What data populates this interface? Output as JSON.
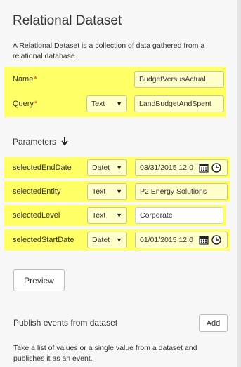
{
  "title": "Relational Dataset",
  "description": "A Relational Dataset is a collection of data gathered from a relational database.",
  "name_field": {
    "label": "Name",
    "required_mark": "*",
    "value": "BudgetVersusActual"
  },
  "query_field": {
    "label": "Query",
    "required_mark": "*",
    "type": "Text",
    "value": "LandBudgetAndSpent"
  },
  "parameters": {
    "heading": "Parameters",
    "items": [
      {
        "name": "selectedEndDate",
        "type": "Datet",
        "value": "03/31/2015 12:0",
        "kind": "datetime"
      },
      {
        "name": "selectedEntity",
        "type": "Text",
        "value": "P2 Energy Solutions",
        "kind": "text"
      },
      {
        "name": "selectedLevel",
        "type": "Text",
        "value": "Corporate",
        "kind": "text"
      },
      {
        "name": "selectedStartDate",
        "type": "Datet",
        "value": "01/01/2015 12:0",
        "kind": "datetime"
      }
    ]
  },
  "preview_button": "Preview",
  "publish": {
    "heading": "Publish events from dataset",
    "add_button": "Add",
    "description": "Take a list of values or a single value from a dataset and publishes it as an event."
  },
  "colors": {
    "highlight": "#ffff66",
    "field_highlight": "#ffffcc",
    "required": "#e0302f",
    "background": "#f7f7f7"
  },
  "icons": {
    "sort": "down-arrow-icon",
    "calendar": "calendar-icon",
    "clock": "clock-icon",
    "dropdown": "caret-down-icon"
  }
}
